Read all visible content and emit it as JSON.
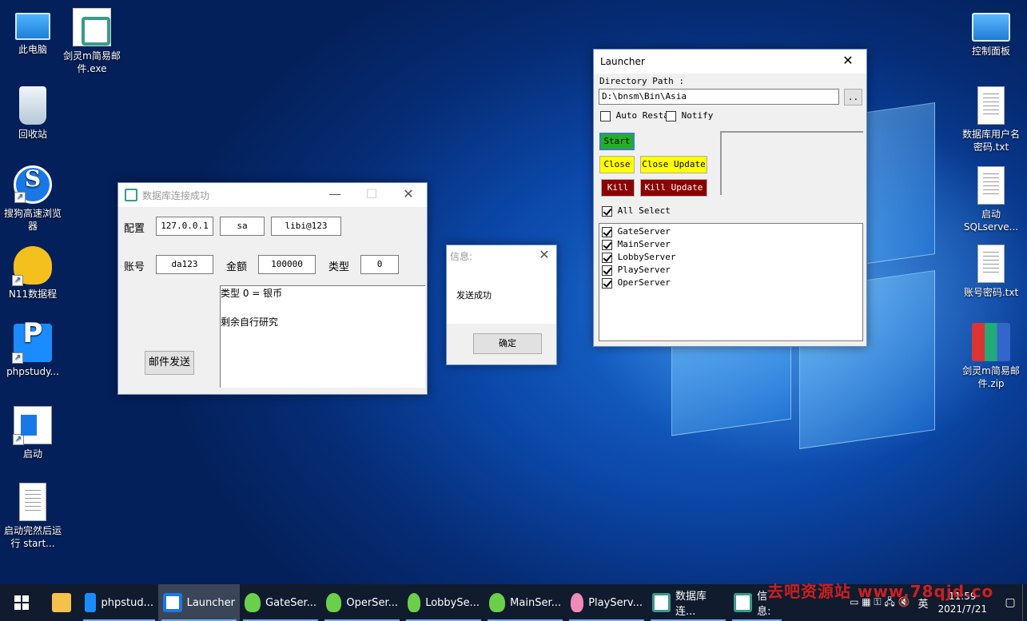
{
  "desktop": {
    "left_icons": [
      {
        "label": "此电脑",
        "icon": "computer-icon"
      },
      {
        "label": "剑灵m简易邮件.exe",
        "icon": "exe-icon"
      },
      {
        "label": "回收站",
        "icon": "recycle-bin-icon"
      },
      {
        "label": "搜狗高速浏览器",
        "icon": "sogou-browser-icon"
      },
      {
        "label": "N11数据程",
        "icon": "n11-icon"
      },
      {
        "label": "phpstudy...",
        "icon": "phpstudy-icon"
      },
      {
        "label": "启动",
        "icon": "launcher-icon"
      },
      {
        "label": "启动完然后运行 start...",
        "icon": "text-file-icon"
      }
    ],
    "right_icons": [
      {
        "label": "控制面板",
        "icon": "control-panel-icon"
      },
      {
        "label": "数据库用户名密码.txt",
        "icon": "text-file-icon"
      },
      {
        "label": "启动SQLserve...",
        "icon": "text-file-icon"
      },
      {
        "label": "账号密码.txt",
        "icon": "text-file-icon"
      },
      {
        "label": "剑灵m简易邮件.zip",
        "icon": "zip-icon"
      }
    ]
  },
  "db_window": {
    "title": "数据库连接成功",
    "config_label": "配置",
    "host": "127.0.0.1",
    "user": "sa",
    "password": "libi@123",
    "account_label": "账号",
    "account": "da123",
    "amount_label": "金额",
    "amount": "100000",
    "type_label": "类型",
    "type": "0",
    "notes": [
      "类型 0 = 银币",
      "剩余自行研究"
    ],
    "send_button": "邮件发送"
  },
  "msg_dialog": {
    "title": "信息:",
    "message": "发送成功",
    "ok_button": "确定"
  },
  "launcher": {
    "title": "Launcher",
    "dir_label": "Directory Path :",
    "dir_value": "D:\\bnsm\\Bin\\Asia",
    "browse_button": "..",
    "auto_restart": "Auto Restar",
    "notify": "Notify",
    "start": "Start",
    "close": "Close",
    "close_update": "Close Update",
    "kill": "Kill",
    "kill_update": "Kill Update",
    "all_select": "All Select",
    "servers": [
      "GateServer",
      "MainServer",
      "LobbyServer",
      "PlayServer",
      "OperServer"
    ],
    "colors": {
      "start": "#22b022",
      "close": "#ffff00",
      "kill": "#8b0000"
    }
  },
  "taskbar": {
    "items": [
      {
        "label": "",
        "icon": "folder-icon"
      },
      {
        "label": "phpstud...",
        "icon": "phpstudy-icon"
      },
      {
        "label": "Launcher",
        "icon": "launcher-icon"
      },
      {
        "label": "GateSer...",
        "icon": "frog-icon"
      },
      {
        "label": "OperSer...",
        "icon": "frog-icon"
      },
      {
        "label": "LobbySe...",
        "icon": "frog-icon"
      },
      {
        "label": "MainSer...",
        "icon": "frog-icon"
      },
      {
        "label": "PlayServ...",
        "icon": "frog-pink-icon"
      },
      {
        "label": "数据库连...",
        "icon": "exe-icon"
      },
      {
        "label": "信息:",
        "icon": "exe-icon"
      }
    ],
    "ime": "英",
    "time": "11:59",
    "date": "2021/7/21",
    "watermark": "去吧资源站 www.78qjd.co"
  }
}
